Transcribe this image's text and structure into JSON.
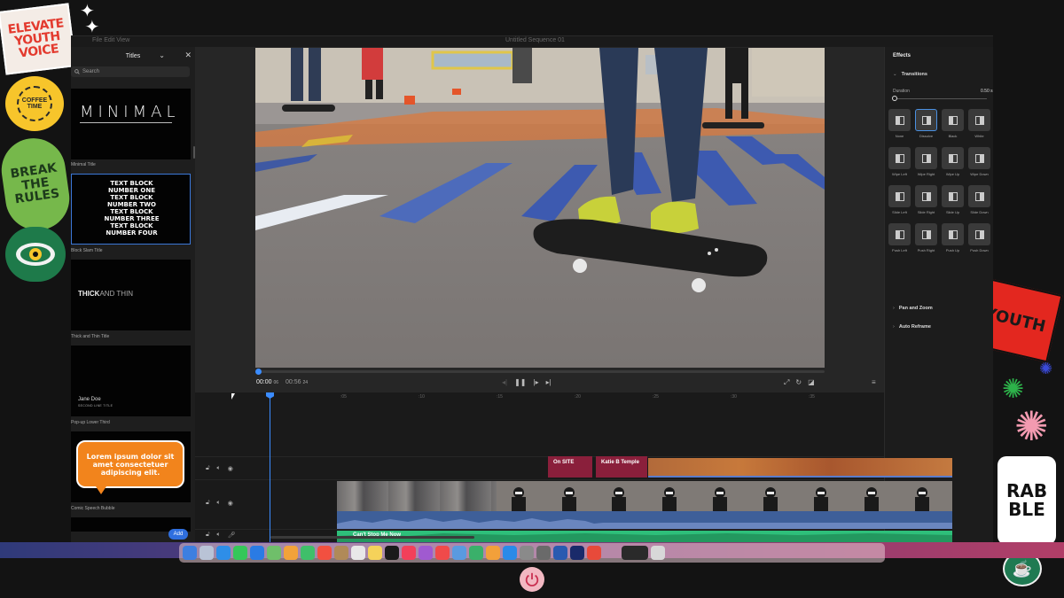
{
  "window": {
    "document_title": "Untitled Sequence 01",
    "menu": "File  Edit  View"
  },
  "titles_panel": {
    "header": "Titles",
    "search_placeholder": "Search",
    "cards": [
      {
        "label": "Minimal Title",
        "preview_text": "MINIMAL"
      },
      {
        "label": "Block Slam Title",
        "preview_lines": [
          "TEXT BLOCK",
          "NUMBER ONE",
          "TEXT BLOCK",
          "NUMBER TWO",
          "TEXT BLOCK",
          "NUMBER THREE",
          "TEXT BLOCK",
          "NUMBER FOUR"
        ]
      },
      {
        "label": "Thick and Thin Title",
        "preview_thick": "THICK",
        "preview_thin": "AND THIN"
      },
      {
        "label": "Pop-up Lower Third",
        "preview_name": "Jane Doe",
        "preview_sub": "SECOND LINE TITLE"
      },
      {
        "label": "Comic Speech Bubble",
        "preview_text": "Lorem ipsum dolor sit amet consectetuer adipiscing elit."
      }
    ],
    "add_label": "Add"
  },
  "viewer": {
    "current_time": "00:00",
    "current_frames": "06",
    "duration": "00:56",
    "duration_frames": "24"
  },
  "timeline": {
    "ruler": [
      ":05",
      ":10",
      ":15",
      ":20",
      ":25",
      ":30",
      ":35"
    ],
    "clips": {
      "title_1": "On SITE",
      "title_2": "Katie B Temple",
      "music": "Can't Stop Me Now"
    }
  },
  "effects_panel": {
    "header": "Effects",
    "transitions_label": "Transitions",
    "duration_label": "Duration",
    "duration_value": "0.50 s",
    "selected_transition": "Dissolve",
    "transitions": [
      "None",
      "Dissolve",
      "Black",
      "White",
      "Wipe Left",
      "Wipe Right",
      "Wipe Up",
      "Wipe Down",
      "Slide Left",
      "Slide Right",
      "Slide Up",
      "Slide Down",
      "Push Left",
      "Push Right",
      "Push Up",
      "Push Down"
    ],
    "pan_zoom_label": "Pan and Zoom",
    "auto_reframe_label": "Auto Reframe"
  },
  "stickers": {
    "elevate": [
      "ELEVATE",
      "YOUTH",
      "VOICE"
    ],
    "coffee": "COFFEE TIME",
    "break_rules": [
      "BREAK",
      "THE",
      "RULES"
    ],
    "youth": "YOUTH",
    "rabble": [
      "RAB",
      "BLE"
    ]
  },
  "colors": {
    "accent": "#3b8cff",
    "title_clip": "#8a1f3b",
    "video_clip": "#3e5f99",
    "audio_clip": "#2ebf7a",
    "dock_gradient": "#6a3a7d"
  }
}
